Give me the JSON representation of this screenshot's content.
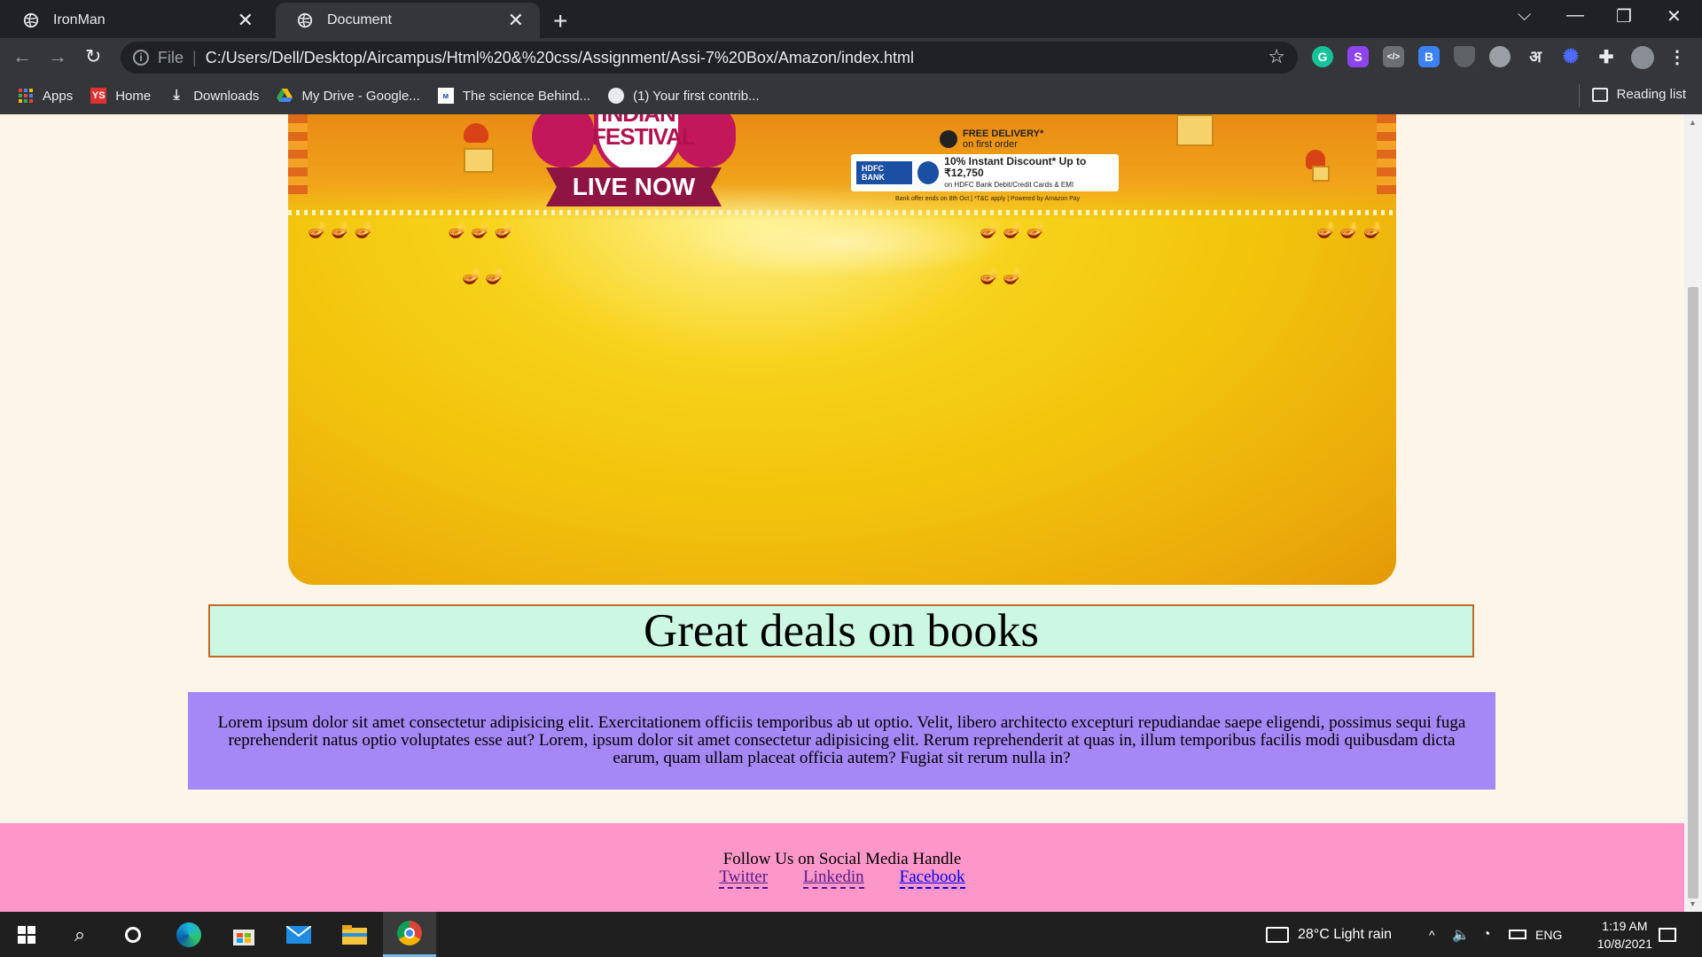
{
  "browser": {
    "tabs": [
      {
        "title": "IronMan",
        "active": false
      },
      {
        "title": "Document",
        "active": true
      }
    ],
    "address": {
      "scheme": "File",
      "url": "C:/Users/Dell/Desktop/Aircampus/Html%20&%20css/Assignment/Assi-7%20Box/Amazon/index.html"
    },
    "extensions": [
      {
        "icon": "grammarly-icon",
        "color": "#15c39a",
        "glyph": "G"
      },
      {
        "icon": "s-extension-icon",
        "color": "#8e44ec",
        "glyph": "S"
      },
      {
        "icon": "code-icon",
        "color": "#6c6f73",
        "glyph": "</>"
      },
      {
        "icon": "translate-box-icon",
        "color": "#3b82f6",
        "glyph": "B"
      },
      {
        "icon": "shield-extension-icon",
        "color": "#5f6368",
        "glyph": ""
      },
      {
        "icon": "circle-extension-icon",
        "color": "#9aa0a6",
        "glyph": ""
      },
      {
        "icon": "hindi-letter-icon",
        "color": "#35363a",
        "glyph": "अ"
      },
      {
        "icon": "sparkle-extension-icon",
        "color": "#3b5bff",
        "glyph": "✺"
      },
      {
        "icon": "puzzle-icon",
        "color": "#35363a",
        "glyph": "✚"
      }
    ],
    "bookmarks": [
      {
        "label": "Apps",
        "icon": "apps-grid-icon"
      },
      {
        "label": "Home",
        "icon": "ys-logo-icon"
      },
      {
        "label": "Downloads",
        "icon": "download-icon"
      },
      {
        "label": "My Drive - Google...",
        "icon": "google-drive-icon"
      },
      {
        "label": "The science Behind...",
        "icon": "article-icon"
      },
      {
        "label": "(1) Your first contrib...",
        "icon": "github-icon"
      }
    ],
    "reading_list": "Reading list"
  },
  "page": {
    "banner": {
      "festival_title": "INDIAN FESTIVAL",
      "live_label": "LIVE NOW",
      "delivery_title": "FREE DELIVERY*",
      "delivery_sub": "on first order",
      "bank_name": "HDFC BANK",
      "bank_offer": "10% Instant Discount* Up to ₹12,750",
      "bank_offer_sub": "on HDFC Bank Debit/Credit Cards & EMI",
      "bank_fineprint": "Bank offer ends on 8th Oct | *T&C apply | Powered by Amazon Pay"
    },
    "heading": "Great deals on books",
    "paragraph": "Lorem ipsum dolor sit amet consectetur adipisicing elit. Exercitationem officiis temporibus ab ut optio. Velit, libero architecto excepturi repudiandae saepe eligendi, possimus sequi fuga reprehenderit natus optio voluptates esse aut? Lorem, ipsum dolor sit amet consectetur adipisicing elit. Rerum reprehenderit at quas in, illum temporibus facilis modi quibusdam dicta earum, quam ullam placeat officia autem? Fugiat sit rerum nulla in?",
    "footer": {
      "follow_text": "Follow Us on Social Media Handle",
      "links": [
        "Twitter",
        "Linkedin",
        "Facebook"
      ]
    }
  },
  "taskbar": {
    "weather": "28°C  Light rain",
    "language": "ENG",
    "time": "1:19 AM",
    "date": "10/8/2021"
  },
  "colors": {
    "heading_bg": "#ccf7e3",
    "paragraph_bg": "#a587f5",
    "footer_bg": "#fd97c9",
    "page_bg": "#fdf5e8"
  }
}
